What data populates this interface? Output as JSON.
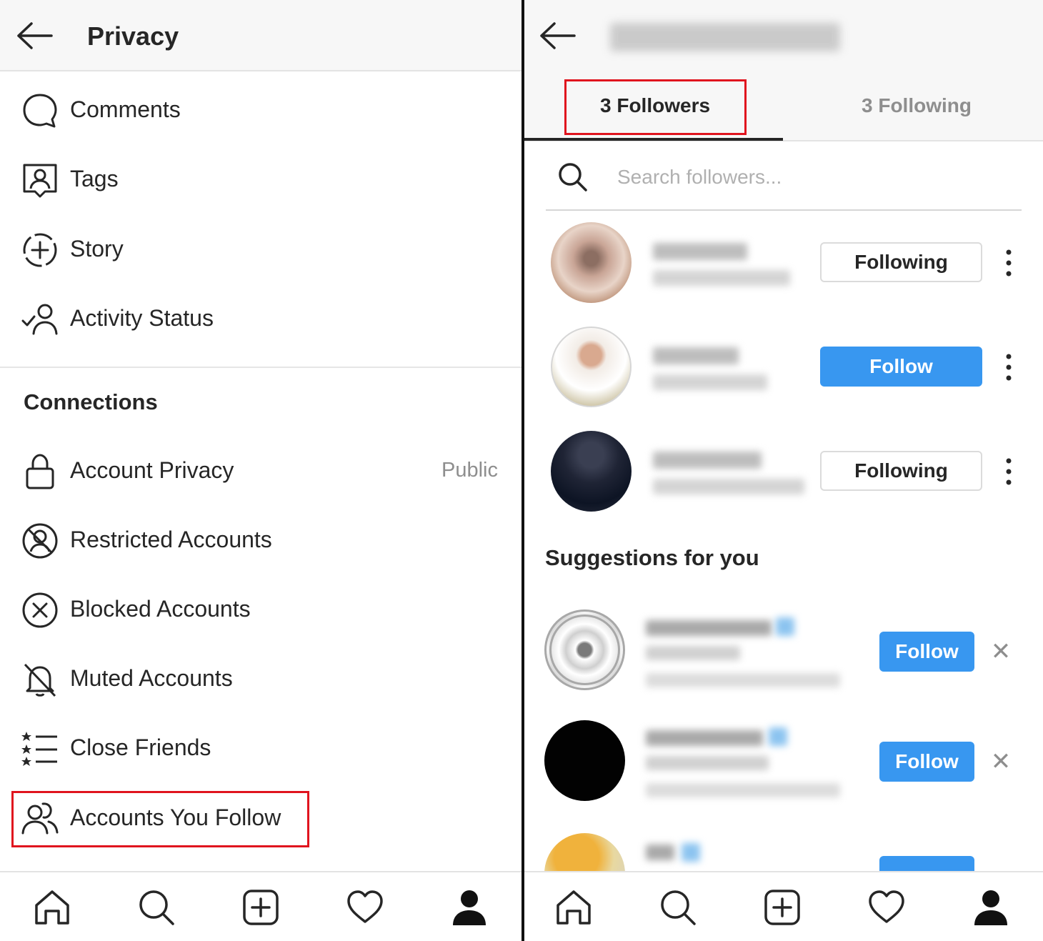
{
  "left": {
    "title": "Privacy",
    "items": [
      {
        "label": "Comments",
        "icon": "comment-icon"
      },
      {
        "label": "Tags",
        "icon": "tag-person-icon"
      },
      {
        "label": "Story",
        "icon": "story-add-icon"
      },
      {
        "label": "Activity Status",
        "icon": "activity-status-icon"
      }
    ],
    "connections_title": "Connections",
    "connections": [
      {
        "label": "Account Privacy",
        "value": "Public",
        "icon": "lock-icon"
      },
      {
        "label": "Restricted Accounts",
        "icon": "restricted-icon"
      },
      {
        "label": "Blocked Accounts",
        "icon": "blocked-icon"
      },
      {
        "label": "Muted Accounts",
        "icon": "muted-bell-icon"
      },
      {
        "label": "Close Friends",
        "icon": "close-friends-icon"
      },
      {
        "label": "Accounts You Follow",
        "icon": "people-icon"
      }
    ]
  },
  "right": {
    "tabs": {
      "followers": "3 Followers",
      "following": "3 Following"
    },
    "search_placeholder": "Search followers...",
    "followers": [
      {
        "button": "Following",
        "state": "following"
      },
      {
        "button": "Follow",
        "state": "follow"
      },
      {
        "button": "Following",
        "state": "following"
      }
    ],
    "suggestions_title": "Suggestions for you",
    "suggestions": [
      {
        "button": "Follow",
        "dismiss": "✕"
      },
      {
        "button": "Follow",
        "dismiss": "✕"
      }
    ]
  },
  "nav_icons": [
    "home-icon",
    "search-icon",
    "new-post-icon",
    "heart-icon",
    "profile-icon"
  ],
  "colors": {
    "accent": "#3897f0",
    "highlight": "#e0141e",
    "text": "#262626",
    "muted": "#8e8e8e"
  }
}
